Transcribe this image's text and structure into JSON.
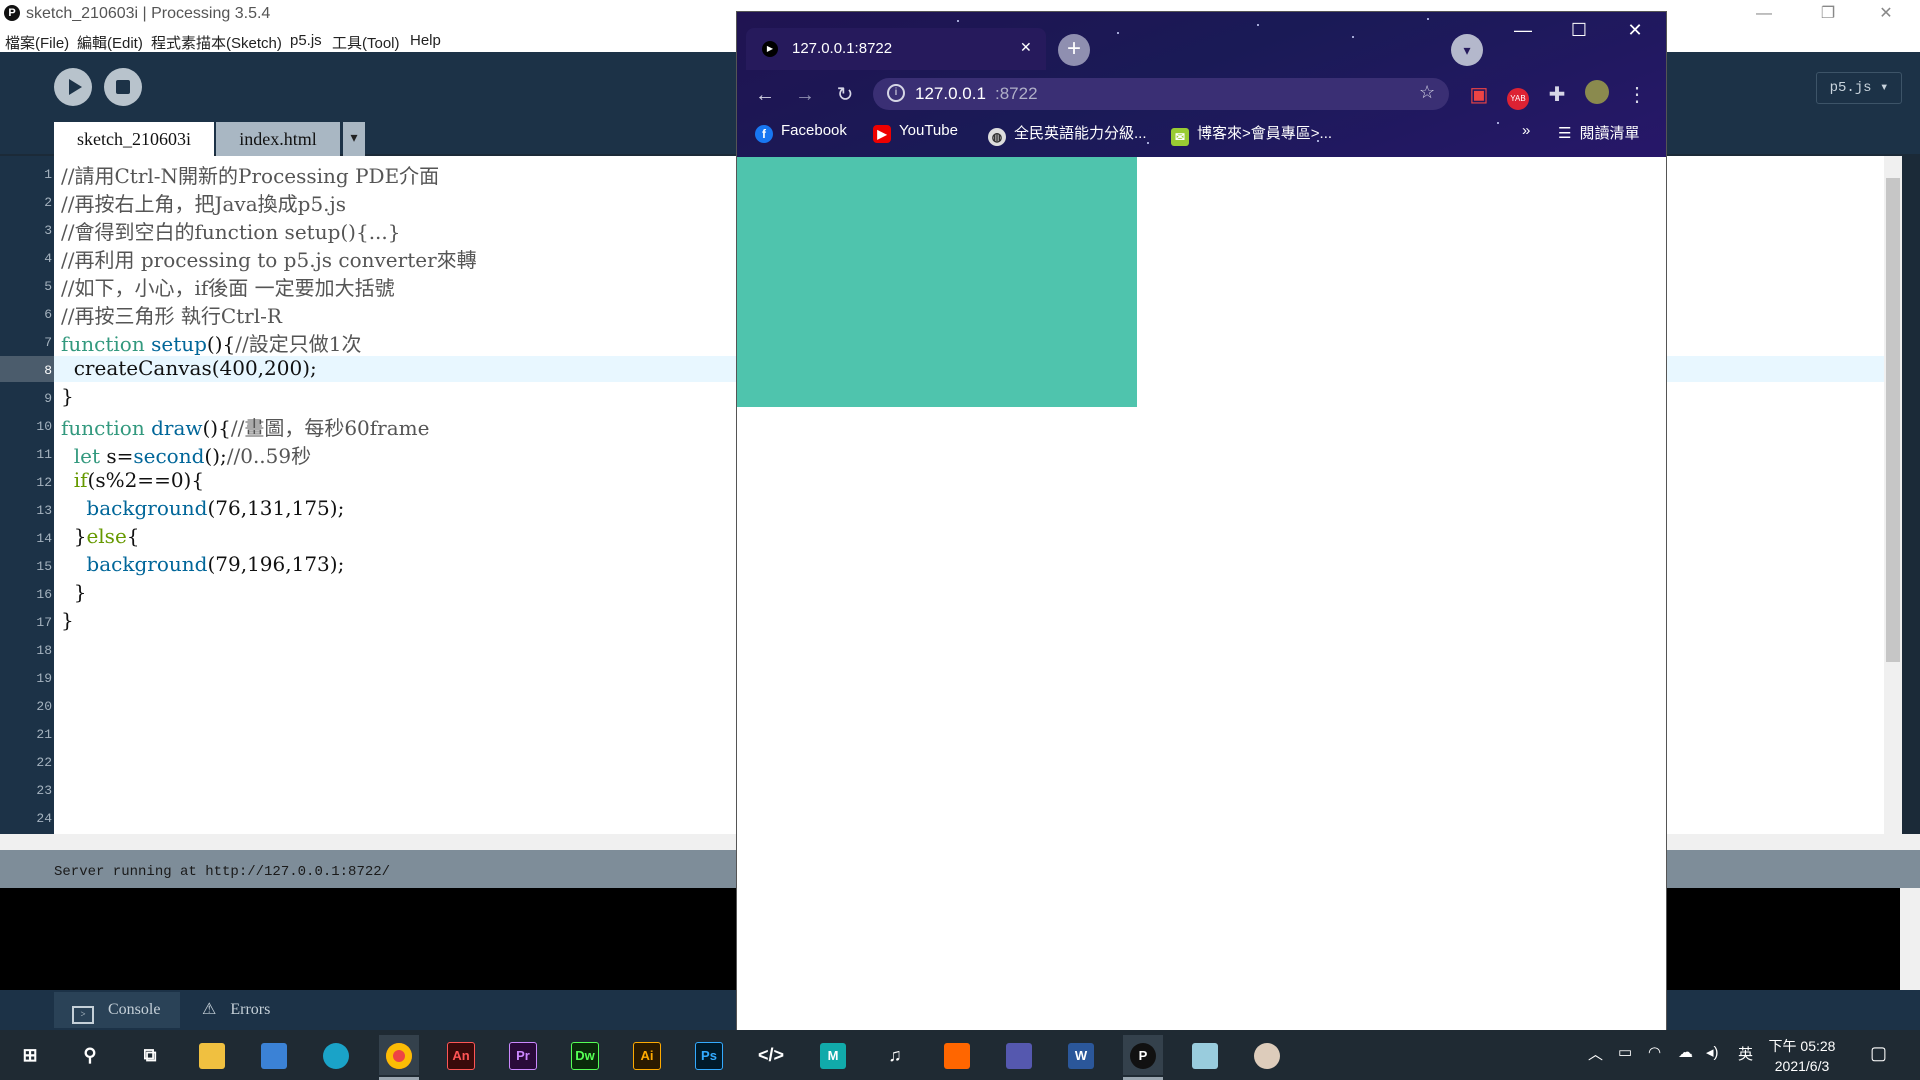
{
  "processing": {
    "window_title": "sketch_210603i | Processing 3.5.4",
    "logo_glyph": "P",
    "menu": [
      "檔案(File)",
      "編輯(Edit)",
      "程式素描本(Sketch)",
      "p5.js",
      "工具(Tool)",
      "Help"
    ],
    "window_controls": {
      "minimize": "—",
      "restore": "❐",
      "close": "✕"
    },
    "tabs": [
      "sketch_210603i",
      "index.html"
    ],
    "tab_more": "▾",
    "mode": "p5.js ▾",
    "line_numbers": [
      "1",
      "2",
      "3",
      "4",
      "5",
      "6",
      "7",
      "8",
      "9",
      "10",
      "11",
      "12",
      "13",
      "14",
      "15",
      "16",
      "17",
      "18",
      "19",
      "20",
      "21",
      "22",
      "23",
      "24"
    ],
    "current_line": 8,
    "code": {
      "l1": "//請用Ctrl-N開新的Processing PDE介面",
      "l2": "//再按右上角，把Java換成p5.js",
      "l3": "//會得到空白的function setup(){...}",
      "l4": "//再利用 processing to p5.js converter來轉",
      "l5": "//如下，小心，if後面 一定要加大括號",
      "l6": "//再按三角形 執行Ctrl-R",
      "l7_kw": "function",
      "l7_fn": "setup",
      "l7_rest": "(){",
      "l7_cm": "//設定只做1次",
      "l8": "  createCanvas(400,200);",
      "l9": "}",
      "l10_kw": "function",
      "l10_fn": "draw",
      "l10_rest": "(){",
      "l10_cm": "//畫圖，每秒60frame",
      "l11_kw": "  let",
      "l11_a": " s=",
      "l11_fn": "second",
      "l11_b": "();",
      "l11_cm": "//0..59秒",
      "l12_kw": "  if",
      "l12_rest": "(s%2==0){",
      "l13_fn": "    background",
      "l13_rest": "(76,131,175);",
      "l14_a": "  }",
      "l14_kw": "else",
      "l14_b": "{",
      "l15_fn": "    background",
      "l15_rest": "(79,196,173);",
      "l16": "  }",
      "l17": "}"
    },
    "status_message": "Server running at http://127.0.0.1:8722/",
    "bottom_tabs": {
      "console": "Console",
      "errors": "Errors"
    }
  },
  "browser": {
    "tab_title": "127.0.0.1:8722",
    "tab_close": "✕",
    "new_tab": "+",
    "url_host": "127.0.0.1",
    "url_port": ":8722",
    "bookmarks": [
      "Facebook",
      "YouTube",
      "全民英語能力分級...",
      "博客來>會員專區>..."
    ],
    "bookmarks_overflow": "»",
    "reading_list": "閱讀清單",
    "window_controls": {
      "minimize": "—",
      "maximize": "☐",
      "close": "✕"
    },
    "canvas_color": "#4fc4ad"
  },
  "taskbar": {
    "apps": [
      "An",
      "Pr",
      "Dw",
      "Ai",
      "Ps",
      "M",
      "W"
    ],
    "ime": "英",
    "time": "下午 05:28",
    "date": "2021/6/3"
  },
  "colors": {
    "processing_dark": "#1c3247",
    "teal_canvas": "#4fc4ad",
    "chrome_purple": "#261a5c"
  }
}
